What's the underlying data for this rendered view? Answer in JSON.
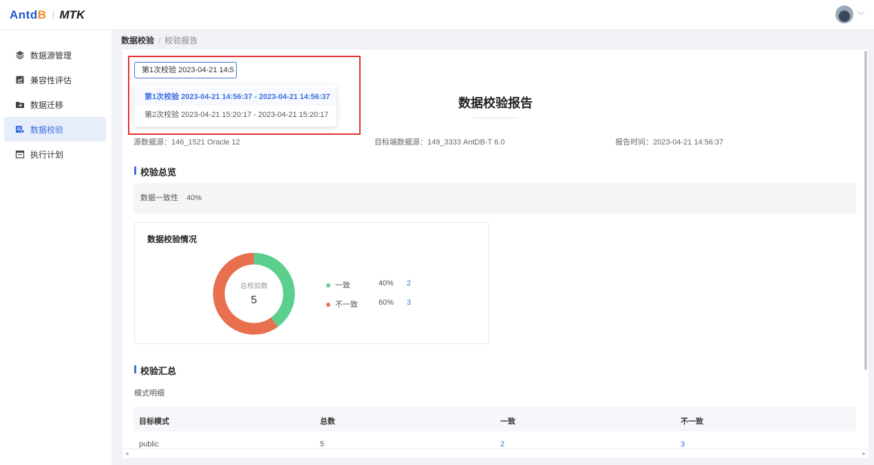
{
  "header": {
    "logo_ant": "Antd",
    "logo_b": "B",
    "logo_mtk": "MTK"
  },
  "sidebar": {
    "items": [
      {
        "label": "数据源管理",
        "icon": "layers-icon"
      },
      {
        "label": "兼容性评估",
        "icon": "assessment-icon"
      },
      {
        "label": "数据迁移",
        "icon": "folder-migrate-icon"
      },
      {
        "label": "数据校验",
        "icon": "verify-icon",
        "active": true
      },
      {
        "label": "执行计划",
        "icon": "calendar-icon"
      }
    ]
  },
  "breadcrumb": {
    "current": "数据校验",
    "separator": "/",
    "page": "校验报告"
  },
  "selector": {
    "value": "第1次校验 2023-04-21 14:5",
    "options": [
      "第1次校验 2023-04-21 14:56:37 - 2023-04-21 14:56:37",
      "第2次校验 2023-04-21 15:20:17 - 2023-04-21 15:20:17"
    ]
  },
  "report": {
    "title": "数据校验报告",
    "source": "源数据源：146_1521 Oracle 12",
    "target": "目标端数据源：149_3333 AntDB-T 6.0",
    "time": "报告时间：2023-04-21 14:56:37"
  },
  "overview": {
    "heading": "校验总览",
    "consistency_label": "数据一致性",
    "consistency_value": "40%"
  },
  "chart_card": {
    "title": "数据校验情况",
    "center_label": "总校验数",
    "center_value": "5"
  },
  "chart_data": {
    "type": "pie",
    "title": "数据校验情况",
    "categories": [
      "一致",
      "不一致"
    ],
    "values": [
      2,
      3
    ],
    "percents": [
      "40%",
      "60%"
    ],
    "colors": [
      "#5ccf8f",
      "#e8704f"
    ],
    "legend": "right"
  },
  "summary": {
    "heading": "校验汇总",
    "sub_label": "模式明细",
    "columns": [
      "目标模式",
      "总数",
      "一致",
      "不一致"
    ],
    "rows": [
      {
        "schema": "public",
        "total": "5",
        "consistent": "2",
        "inconsistent": "3"
      }
    ]
  },
  "colors": {
    "primary": "#3b6fdc",
    "highlight": "#e03030"
  }
}
